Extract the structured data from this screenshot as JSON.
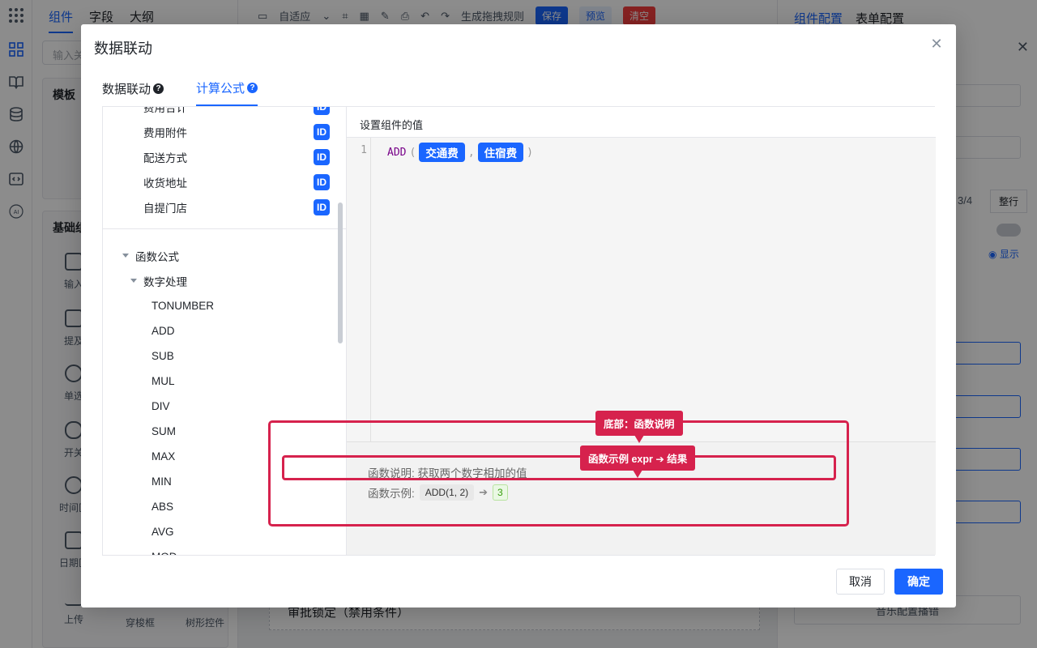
{
  "background": {
    "left_tabs": [
      "组件",
      "字段",
      "大纲"
    ],
    "search_placeholder": "输入关",
    "template_card_title": "模板",
    "basic_card_title": "基础组",
    "components": [
      "输入",
      "提及",
      "单选",
      "开关",
      "时间区",
      "日期区",
      "上传",
      "穿梭框",
      "树形控件"
    ],
    "toolbar": {
      "adaptive_label": "自适应",
      "generate_rules_label": "生成拖拽规则",
      "save_label": "保存",
      "preview_label": "预览",
      "clear_label": "清空"
    },
    "canvas_text": "审批锁定（禁用条件）",
    "right_tabs": [
      "组件配置",
      "表单配置"
    ],
    "right_ratio": "3/4",
    "right_fullrow": "整行",
    "right_show": "显示",
    "right_bottom_text": "音乐配置播错"
  },
  "modal": {
    "title": "数据联动",
    "tabs": [
      {
        "label": "数据联动",
        "active": false
      },
      {
        "label": "计算公式",
        "active": true
      }
    ],
    "field_items": [
      {
        "label": "费用合计",
        "badge": "ID"
      },
      {
        "label": "费用附件",
        "badge": "ID"
      },
      {
        "label": "配送方式",
        "badge": "ID"
      },
      {
        "label": "收货地址",
        "badge": "ID"
      },
      {
        "label": "自提门店",
        "badge": "ID"
      }
    ],
    "function_group": "函数公式",
    "function_subgroup": "数字处理",
    "functions": [
      "TONUMBER",
      "ADD",
      "SUB",
      "MUL",
      "DIV",
      "SUM",
      "MAX",
      "MIN",
      "ABS",
      "AVG",
      "MOD"
    ],
    "editor_title": "设置组件的值",
    "line_number": "1",
    "formula": {
      "fn": "ADD",
      "open_paren": "(",
      "arg1": "交通费",
      "comma": ",",
      "arg2": "住宿费",
      "close_paren": ")"
    },
    "description_label": "函数说明: 获取两个数字相加的值",
    "example_label": "函数示例:",
    "example_expr": "ADD(1, 2)",
    "example_arrow": "➔",
    "example_result": "3",
    "cancel_label": "取消",
    "confirm_label": "确定"
  },
  "annotations": {
    "callout_top": "底部：函数说明",
    "callout_mid": "函数示例 expr ➔ 结果",
    "highlight_color": "#d6224d"
  }
}
